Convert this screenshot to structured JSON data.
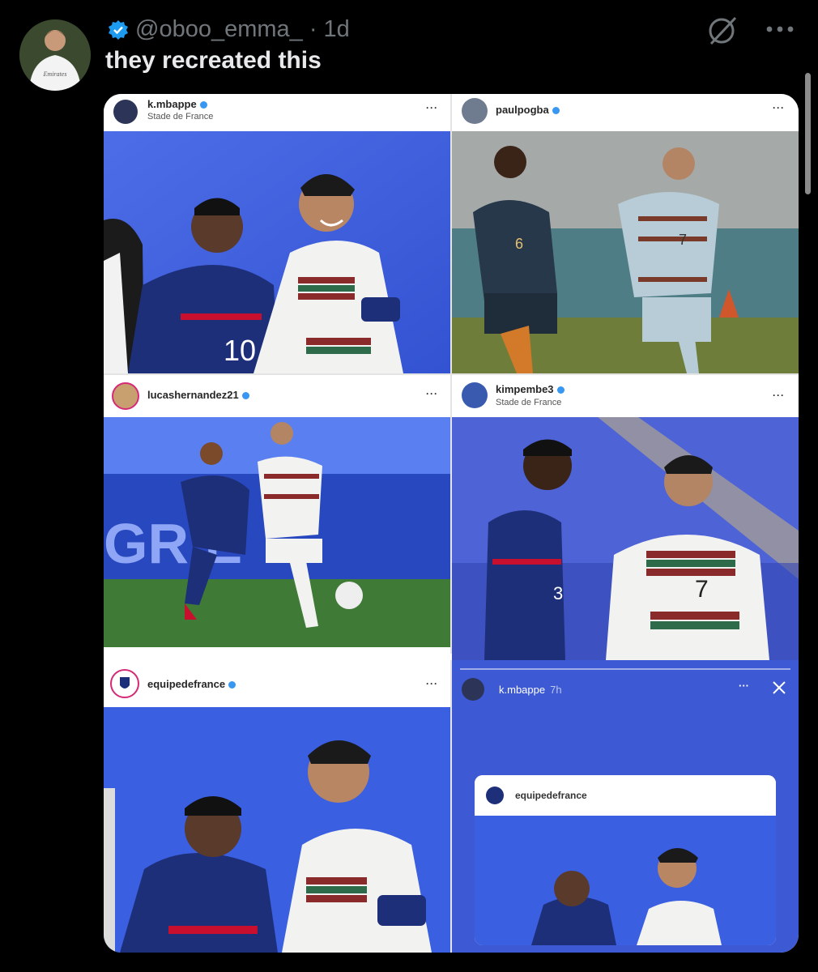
{
  "tweet": {
    "handle": "@oboo_emma_ · 1d",
    "text": "they recreated this",
    "avatar_icon": "profile-photo-icon",
    "verified_icon": "verified-badge-icon",
    "grok_icon": "grok-icon",
    "more_icon": "more-horizontal-icon"
  },
  "posts": [
    {
      "user": "k.mbappe",
      "location": "Stade de France",
      "verified": true
    },
    {
      "user": "paulpogba",
      "location": "",
      "verified": true
    },
    {
      "user": "lucashernandez21",
      "location": "",
      "verified": true
    },
    {
      "user": "kimpembe3",
      "location": "Stade de France",
      "verified": true
    },
    {
      "user": "equipedefrance",
      "location": "",
      "verified": true
    }
  ],
  "story": {
    "user": "k.mbappe",
    "time": "7h",
    "shared_user": "equipedefrance",
    "more_icon": "more-dots-icon",
    "close_icon": "close-icon"
  },
  "jerseys": {
    "n10": "10",
    "n6": "6",
    "n7": "7",
    "n3": "3"
  },
  "banner": {
    "stadium_text": "GR    E"
  },
  "colors": {
    "france_blue": "#1e2f7a",
    "portugal_white": "#f2f2f0",
    "portugal_red": "#8b2a2a",
    "portugal_green": "#2e6b4a",
    "ig_verified": "#3897f0"
  }
}
